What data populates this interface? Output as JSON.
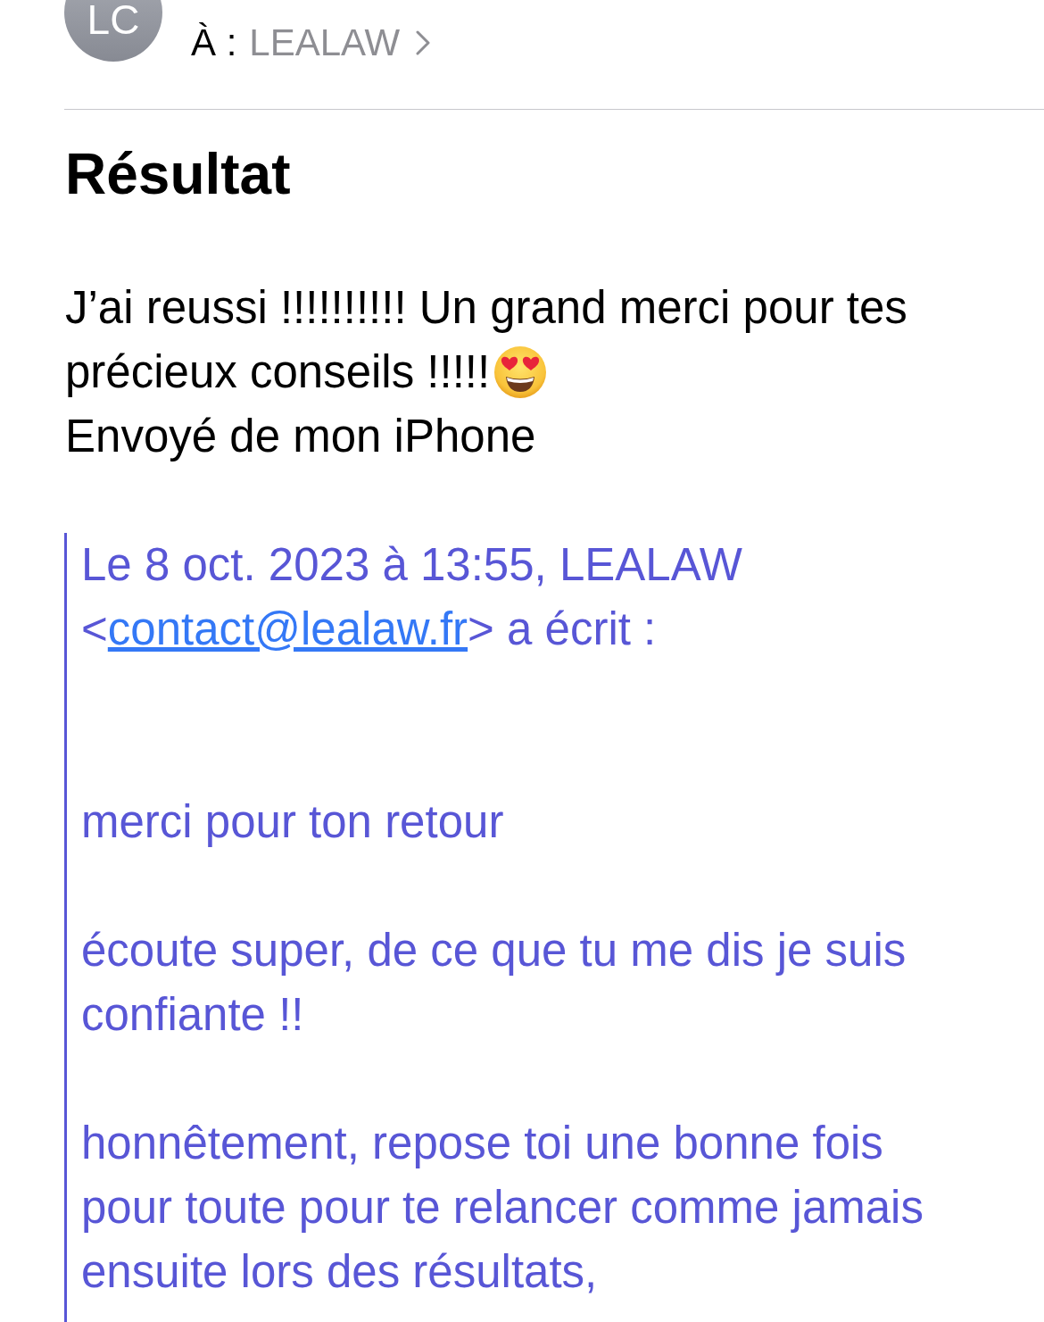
{
  "header": {
    "avatar": {
      "initials": "LC"
    },
    "recipient": {
      "label": "À :",
      "name": "LEALAW"
    }
  },
  "message": {
    "subject": "Résultat",
    "body_lines": [
      "J’ai reussi !!!!!!!!!! Un grand merci pour tes",
      "précieux conseils !!!!!"
    ],
    "signature": "Envoyé de mon iPhone"
  },
  "quote": {
    "attribution": {
      "before": "Le 8 oct. 2023 à 13:55, LEALAW <",
      "link": "contact@lealaw.fr",
      "after": "> a écrit :"
    },
    "paragraphs": [
      "merci pour ton retour",
      "écoute super, de ce que tu me dis je suis confiante !!",
      "honnêtement, repose toi une bonne fois pour toute pour te relancer comme jamais ensuite lors des résultats,"
    ]
  }
}
